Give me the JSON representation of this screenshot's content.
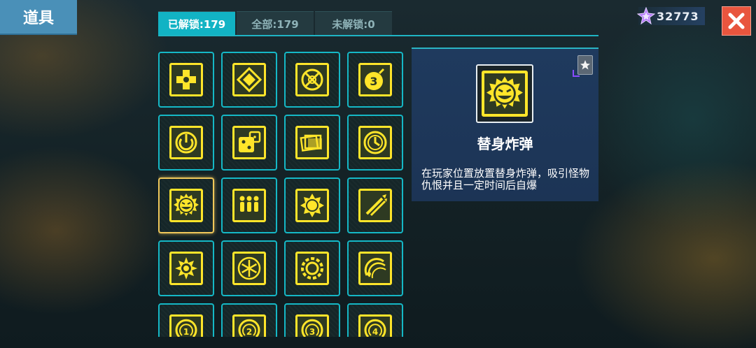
{
  "header": {
    "title": "道具"
  },
  "tabs": [
    {
      "label": "已解锁:179",
      "active": true
    },
    {
      "label": "全部:179",
      "active": false
    },
    {
      "label": "未解锁:0",
      "active": false
    }
  ],
  "currency": {
    "amount": "32773",
    "icon": "purple-star-gem-icon"
  },
  "close_icon": "close-icon",
  "colors": {
    "accent": "#15b8c6",
    "icon_yellow": "#ffe52a",
    "close_red": "#e8553e",
    "active_tab": "#12b3c4"
  },
  "items": [
    {
      "icon": "puzzle-cross-icon"
    },
    {
      "icon": "diamond-icon"
    },
    {
      "icon": "crosshair-circle-icon"
    },
    {
      "icon": "bomb-3-icon"
    },
    {
      "icon": "power-ring-icon"
    },
    {
      "icon": "dice-icon"
    },
    {
      "icon": "cards-icon"
    },
    {
      "icon": "clock-icon"
    },
    {
      "icon": "grinning-bomb-icon",
      "selected": true
    },
    {
      "icon": "three-people-icon"
    },
    {
      "icon": "sun-orb-icon"
    },
    {
      "icon": "missiles-icon"
    },
    {
      "icon": "spiked-gear-icon"
    },
    {
      "icon": "snowflake-icon"
    },
    {
      "icon": "spiked-ring-icon"
    },
    {
      "icon": "swirl-claw-icon"
    },
    {
      "icon": "swirl-1-icon"
    },
    {
      "icon": "swirl-2-icon"
    },
    {
      "icon": "swirl-3-icon"
    },
    {
      "icon": "swirl-4-icon"
    }
  ],
  "detail": {
    "name": "替身炸弹",
    "description": "在玩家位置放置替身炸弹，吸引怪物仇恨并且一定时间后自爆",
    "icon": "grinning-bomb-icon",
    "badge_icon": "star-badge-icon"
  }
}
